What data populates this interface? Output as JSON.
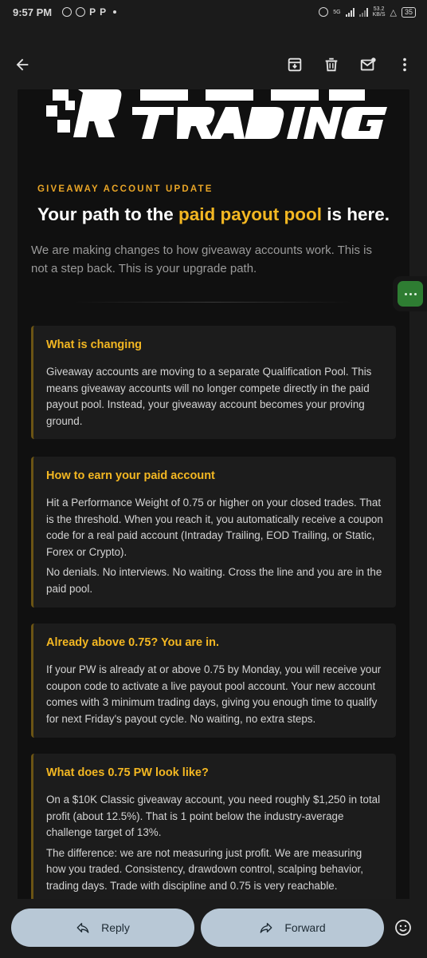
{
  "status_bar": {
    "time": "9:57 PM",
    "net_top": "5G",
    "net_speed_top": "53.2",
    "net_speed_unit": "KB/S",
    "battery": "35"
  },
  "email": {
    "eyebrow": "GIVEAWAY ACCOUNT UPDATE",
    "headline_pre": "Your path to the ",
    "headline_highlight": "paid payout pool",
    "headline_post": " is here.",
    "intro": "We are making changes to how giveaway accounts work. This is not a step back. This is your upgrade path.",
    "cards": [
      {
        "title": "What is changing",
        "paragraphs": [
          "Giveaway accounts are moving to a separate Qualification Pool. This means giveaway accounts will no longer compete directly in the paid payout pool. Instead, your giveaway account becomes your proving ground."
        ]
      },
      {
        "title": "How to earn your paid account",
        "paragraphs": [
          "Hit a Performance Weight of 0.75 or higher on your closed trades. That is the threshold. When you reach it, you automatically receive a coupon code for a real paid account (Intraday Trailing, EOD Trailing, or Static, Forex or Crypto).",
          "No denials. No interviews. No waiting. Cross the line and you are in the paid pool."
        ]
      },
      {
        "title": "Already above 0.75? You are in.",
        "paragraphs": [
          "If your PW is already at or above 0.75 by Monday, you will receive your coupon code to activate a live payout pool account. Your new account comes with 3 minimum trading days, giving you enough time to qualify for next Friday's payout cycle. No waiting, no extra steps."
        ]
      },
      {
        "title": "What does 0.75 PW look like?",
        "paragraphs": [
          "On a $10K Classic giveaway account, you need roughly $1,250 in total profit (about 12.5%). That is 1 point below the industry-average challenge target of 13%.",
          "The difference: we are not measuring just profit. We are measuring how you traded. Consistency, drawdown control, scalping behavior, trading days. Trade with discipline and 0.75 is very reachable."
        ]
      }
    ]
  },
  "actions": {
    "reply": "Reply",
    "forward": "Forward"
  },
  "colors": {
    "accent": "#f3b722",
    "background": "#1b1b1b",
    "email_bg": "#101010",
    "card_bg": "#1c1c1c",
    "pill_bg": "#b8c8d6",
    "chip_green": "#2e7d32"
  },
  "icons": [
    "back-arrow-icon",
    "archive-icon",
    "delete-icon",
    "mark-unread-icon",
    "more-vert-icon",
    "reply-icon",
    "forward-icon",
    "emoji-icon"
  ]
}
